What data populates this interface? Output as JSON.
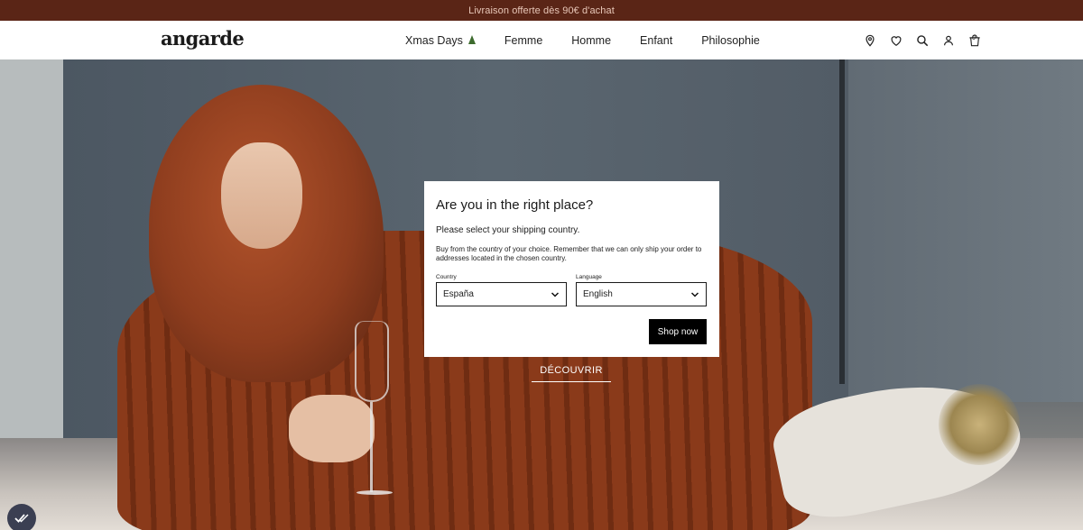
{
  "announcement": "Livraison offerte dès 90€ d'achat",
  "header": {
    "logo": "angarde",
    "nav": [
      {
        "label": "Xmas Days",
        "icon": "christmas-tree-icon"
      },
      {
        "label": "Femme"
      },
      {
        "label": "Homme"
      },
      {
        "label": "Enfant"
      },
      {
        "label": "Philosophie"
      }
    ],
    "icons": [
      "location-pin-icon",
      "heart-icon",
      "search-icon",
      "user-icon",
      "cart-icon"
    ],
    "cart_count": "0"
  },
  "hero": {
    "cta": "DÉCOUVRIR"
  },
  "modal": {
    "title": "Are you in the right place?",
    "subtitle": "Please select your shipping country.",
    "body": "Buy from the country of your choice. Remember that we can only ship your order to addresses located in the chosen country.",
    "country_label": "Country",
    "country_value": "España",
    "language_label": "Language",
    "language_value": "English",
    "button": "Shop now"
  },
  "colors": {
    "announcement_bg": "#5a2516",
    "button_bg": "#000000"
  }
}
